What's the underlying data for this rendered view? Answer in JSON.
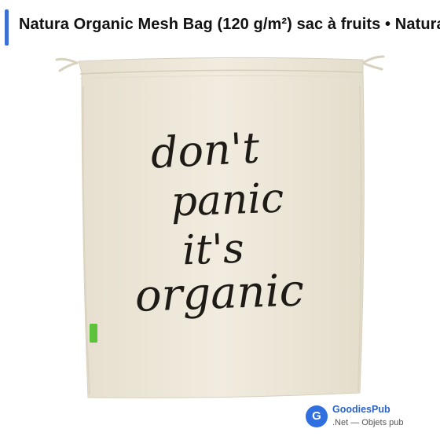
{
  "title": "Natura Organic Mesh Bag (120 g/m²) sac à fruits • Natura",
  "bag": {
    "slogan_lines": [
      "don't",
      "panic",
      "it's",
      "organic"
    ],
    "fabric_color": "#efe9dc",
    "tag_color": "#5cc23a"
  },
  "source": {
    "logo_letter": "G",
    "name": "GoodiesPub",
    "subtitle": ".Net — Objets pub"
  },
  "colors": {
    "accent": "#3b6fd4",
    "ink": "#1e1a16"
  }
}
